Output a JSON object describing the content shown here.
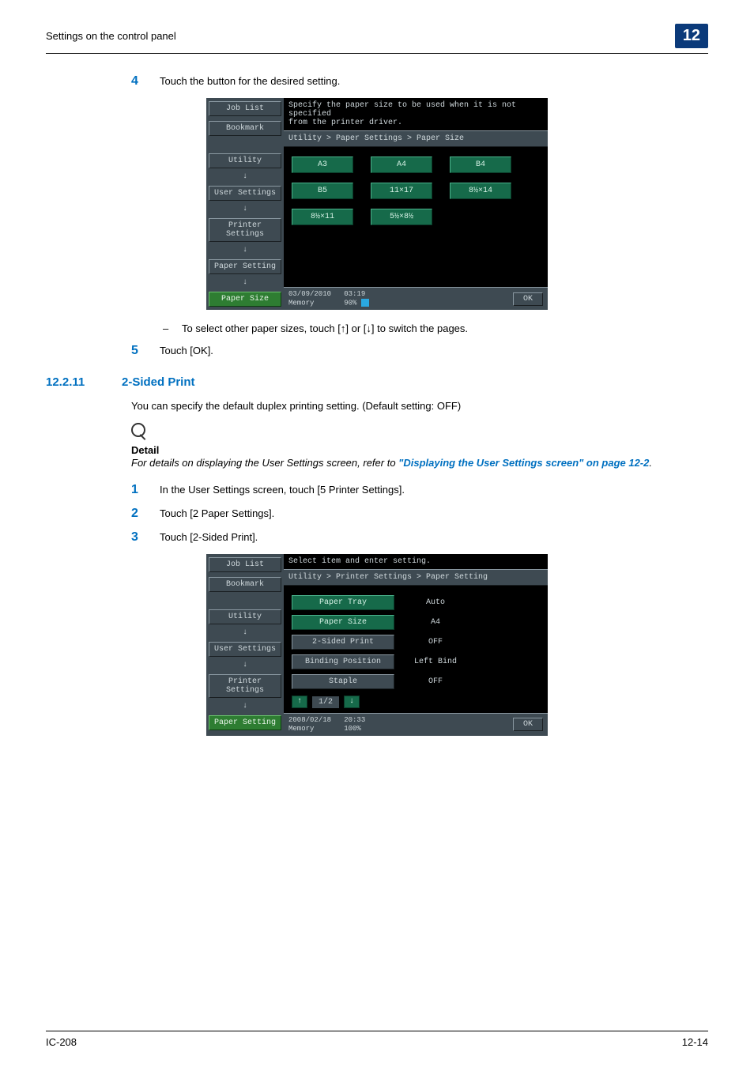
{
  "header": {
    "left": "Settings on the control panel",
    "chapter": "12"
  },
  "step4": {
    "num": "4",
    "text": "Touch the button for the desired setting."
  },
  "panel1": {
    "left": {
      "joblist": "Job List",
      "bookmark": "Bookmark",
      "items": [
        "Utility",
        "User Settings",
        "Printer Settings",
        "Paper Setting"
      ],
      "active": "Paper Size"
    },
    "top": "Specify the paper size to be used when it is not specified\nfrom the printer driver.",
    "crumb": "Utility > Paper Settings > Paper Size",
    "sizes": [
      "A3",
      "A4",
      "B4",
      "B5",
      "11×17",
      "8½×14",
      "8½×11",
      "5½×8½"
    ],
    "foot": {
      "left": "03/09/2010   03:19\nMemory       90%",
      "ok": "OK"
    }
  },
  "dash1": "To select other paper sizes, touch [↑] or [↓] to switch the pages.",
  "step5": {
    "num": "5",
    "text": "Touch [OK]."
  },
  "section": {
    "num": "12.2.11",
    "title": "2-Sided Print"
  },
  "intro": "You can specify the default duplex printing setting. (Default setting: OFF)",
  "note": {
    "head": "Detail",
    "body_pre": "For details on displaying the User Settings screen, refer to ",
    "link": "\"Displaying the User Settings screen\" on page 12-2",
    "body_post": "."
  },
  "step1": {
    "num": "1",
    "text": "In the User Settings screen, touch [5 Printer Settings]."
  },
  "step2": {
    "num": "2",
    "text": "Touch [2 Paper Settings]."
  },
  "step3": {
    "num": "3",
    "text": "Touch [2-Sided Print]."
  },
  "panel2": {
    "left": {
      "joblist": "Job List",
      "bookmark": "Bookmark",
      "items": [
        "Utility",
        "User Settings",
        "Printer Settings"
      ],
      "active": "Paper Setting"
    },
    "top": "Select item and enter setting.",
    "crumb": "Utility > Printer Settings > Paper Setting",
    "rows": [
      {
        "label": "Paper Tray",
        "value": "Auto",
        "green": true
      },
      {
        "label": "Paper Size",
        "value": "A4",
        "green": true
      },
      {
        "label": "2-Sided Print",
        "value": "OFF",
        "green": false
      },
      {
        "label": "Binding Position",
        "value": "Left Bind",
        "green": false
      },
      {
        "label": "Staple",
        "value": "OFF",
        "green": false
      }
    ],
    "pager": {
      "up": "↑",
      "label": "1/2",
      "down": "↓"
    },
    "foot": {
      "left": "2008/02/18   20:33\nMemory       100%",
      "ok": "OK"
    }
  },
  "footer": {
    "left": "IC-208",
    "right": "12-14"
  }
}
